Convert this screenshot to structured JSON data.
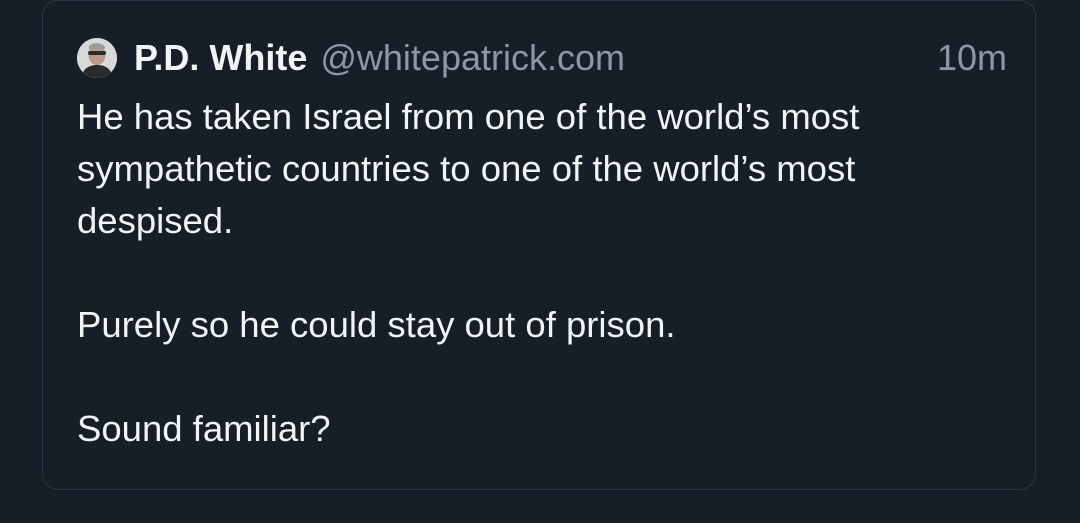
{
  "post": {
    "author_name": "P.D. White",
    "author_handle": "@whitepatrick.com",
    "timestamp": "10m",
    "paragraphs": [
      "He has taken Israel from one of the world’s most sympathetic countries to one of the world’s most despised.",
      "Purely so he could stay out of prison.",
      "Sound familiar?"
    ]
  },
  "colors": {
    "background": "#161e27",
    "card_border": "#2c3642",
    "primary_text": "#f1f3f5",
    "secondary_text": "#8d98a6"
  }
}
